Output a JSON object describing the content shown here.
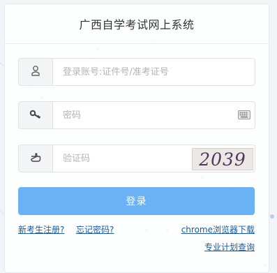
{
  "app": {
    "title": "广西自学考试网上系统"
  },
  "form": {
    "account_placeholder": "登录账号:证件号/准考证号",
    "password_placeholder": "密码",
    "captcha_placeholder": "验证码",
    "captcha_text": "2039"
  },
  "actions": {
    "login_label": "登录",
    "register_link": "新考生注册?",
    "forgot_link": "忘记密码?",
    "chrome_link": "chrome浏览器下载",
    "plan_link": "专业计划查询"
  },
  "icons": {
    "user": "user-icon",
    "key": "key-icon",
    "keyboard": "keyboard-icon",
    "pointer": "hand-pointer-icon"
  },
  "colors": {
    "primary_button": "#6bb2f5",
    "link": "#1a5aa6",
    "title": "#333333"
  }
}
